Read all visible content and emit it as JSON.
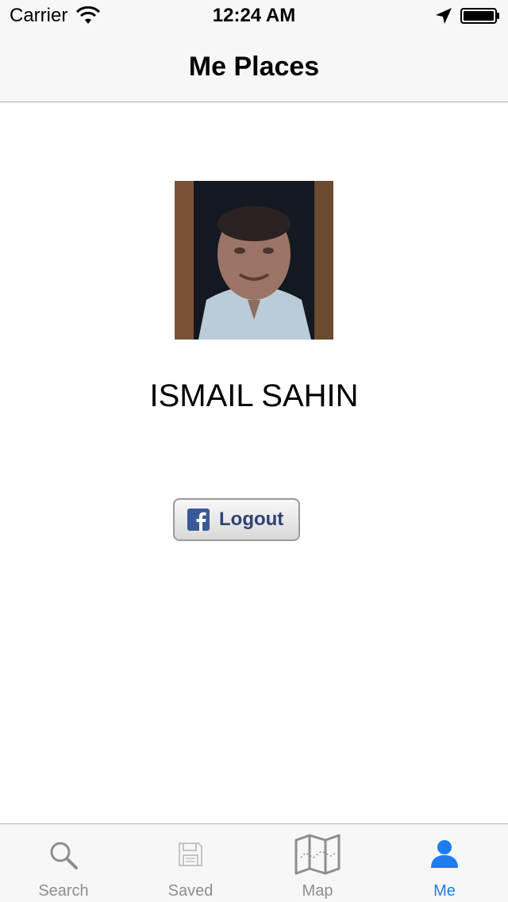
{
  "status_bar": {
    "carrier": "Carrier",
    "time": "12:24 AM",
    "wifi_icon": "wifi-icon",
    "location_icon": "location-arrow-icon",
    "battery_icon": "battery-full-icon"
  },
  "nav": {
    "title": "Me Places"
  },
  "profile": {
    "name": "ISMAIL SAHIN",
    "avatar": "profile-photo"
  },
  "logout": {
    "label": "Logout",
    "icon": "facebook-icon",
    "text_color": "#2d4373"
  },
  "tabs": [
    {
      "label": "Search",
      "icon": "search-icon",
      "active": false
    },
    {
      "label": "Saved",
      "icon": "floppy-disk-icon",
      "active": false
    },
    {
      "label": "Map",
      "icon": "map-icon",
      "active": false
    },
    {
      "label": "Me",
      "icon": "person-icon",
      "active": true
    }
  ],
  "colors": {
    "active_tab": "#1d7df0",
    "inactive_tab": "#8e8e8e",
    "bar_background": "#f7f7f7"
  }
}
